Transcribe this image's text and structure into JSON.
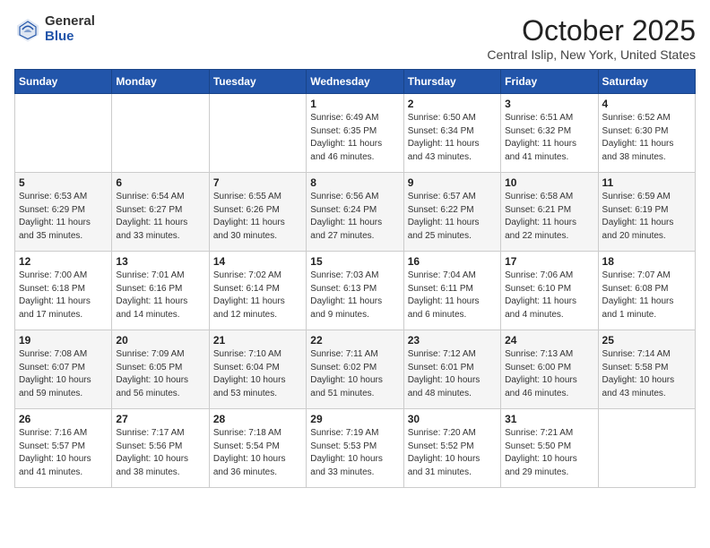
{
  "header": {
    "logo_general": "General",
    "logo_blue": "Blue",
    "month_title": "October 2025",
    "location": "Central Islip, New York, United States"
  },
  "days_of_week": [
    "Sunday",
    "Monday",
    "Tuesday",
    "Wednesday",
    "Thursday",
    "Friday",
    "Saturday"
  ],
  "weeks": [
    [
      {
        "day": "",
        "info": ""
      },
      {
        "day": "",
        "info": ""
      },
      {
        "day": "",
        "info": ""
      },
      {
        "day": "1",
        "info": "Sunrise: 6:49 AM\nSunset: 6:35 PM\nDaylight: 11 hours\nand 46 minutes."
      },
      {
        "day": "2",
        "info": "Sunrise: 6:50 AM\nSunset: 6:34 PM\nDaylight: 11 hours\nand 43 minutes."
      },
      {
        "day": "3",
        "info": "Sunrise: 6:51 AM\nSunset: 6:32 PM\nDaylight: 11 hours\nand 41 minutes."
      },
      {
        "day": "4",
        "info": "Sunrise: 6:52 AM\nSunset: 6:30 PM\nDaylight: 11 hours\nand 38 minutes."
      }
    ],
    [
      {
        "day": "5",
        "info": "Sunrise: 6:53 AM\nSunset: 6:29 PM\nDaylight: 11 hours\nand 35 minutes."
      },
      {
        "day": "6",
        "info": "Sunrise: 6:54 AM\nSunset: 6:27 PM\nDaylight: 11 hours\nand 33 minutes."
      },
      {
        "day": "7",
        "info": "Sunrise: 6:55 AM\nSunset: 6:26 PM\nDaylight: 11 hours\nand 30 minutes."
      },
      {
        "day": "8",
        "info": "Sunrise: 6:56 AM\nSunset: 6:24 PM\nDaylight: 11 hours\nand 27 minutes."
      },
      {
        "day": "9",
        "info": "Sunrise: 6:57 AM\nSunset: 6:22 PM\nDaylight: 11 hours\nand 25 minutes."
      },
      {
        "day": "10",
        "info": "Sunrise: 6:58 AM\nSunset: 6:21 PM\nDaylight: 11 hours\nand 22 minutes."
      },
      {
        "day": "11",
        "info": "Sunrise: 6:59 AM\nSunset: 6:19 PM\nDaylight: 11 hours\nand 20 minutes."
      }
    ],
    [
      {
        "day": "12",
        "info": "Sunrise: 7:00 AM\nSunset: 6:18 PM\nDaylight: 11 hours\nand 17 minutes."
      },
      {
        "day": "13",
        "info": "Sunrise: 7:01 AM\nSunset: 6:16 PM\nDaylight: 11 hours\nand 14 minutes."
      },
      {
        "day": "14",
        "info": "Sunrise: 7:02 AM\nSunset: 6:14 PM\nDaylight: 11 hours\nand 12 minutes."
      },
      {
        "day": "15",
        "info": "Sunrise: 7:03 AM\nSunset: 6:13 PM\nDaylight: 11 hours\nand 9 minutes."
      },
      {
        "day": "16",
        "info": "Sunrise: 7:04 AM\nSunset: 6:11 PM\nDaylight: 11 hours\nand 6 minutes."
      },
      {
        "day": "17",
        "info": "Sunrise: 7:06 AM\nSunset: 6:10 PM\nDaylight: 11 hours\nand 4 minutes."
      },
      {
        "day": "18",
        "info": "Sunrise: 7:07 AM\nSunset: 6:08 PM\nDaylight: 11 hours\nand 1 minute."
      }
    ],
    [
      {
        "day": "19",
        "info": "Sunrise: 7:08 AM\nSunset: 6:07 PM\nDaylight: 10 hours\nand 59 minutes."
      },
      {
        "day": "20",
        "info": "Sunrise: 7:09 AM\nSunset: 6:05 PM\nDaylight: 10 hours\nand 56 minutes."
      },
      {
        "day": "21",
        "info": "Sunrise: 7:10 AM\nSunset: 6:04 PM\nDaylight: 10 hours\nand 53 minutes."
      },
      {
        "day": "22",
        "info": "Sunrise: 7:11 AM\nSunset: 6:02 PM\nDaylight: 10 hours\nand 51 minutes."
      },
      {
        "day": "23",
        "info": "Sunrise: 7:12 AM\nSunset: 6:01 PM\nDaylight: 10 hours\nand 48 minutes."
      },
      {
        "day": "24",
        "info": "Sunrise: 7:13 AM\nSunset: 6:00 PM\nDaylight: 10 hours\nand 46 minutes."
      },
      {
        "day": "25",
        "info": "Sunrise: 7:14 AM\nSunset: 5:58 PM\nDaylight: 10 hours\nand 43 minutes."
      }
    ],
    [
      {
        "day": "26",
        "info": "Sunrise: 7:16 AM\nSunset: 5:57 PM\nDaylight: 10 hours\nand 41 minutes."
      },
      {
        "day": "27",
        "info": "Sunrise: 7:17 AM\nSunset: 5:56 PM\nDaylight: 10 hours\nand 38 minutes."
      },
      {
        "day": "28",
        "info": "Sunrise: 7:18 AM\nSunset: 5:54 PM\nDaylight: 10 hours\nand 36 minutes."
      },
      {
        "day": "29",
        "info": "Sunrise: 7:19 AM\nSunset: 5:53 PM\nDaylight: 10 hours\nand 33 minutes."
      },
      {
        "day": "30",
        "info": "Sunrise: 7:20 AM\nSunset: 5:52 PM\nDaylight: 10 hours\nand 31 minutes."
      },
      {
        "day": "31",
        "info": "Sunrise: 7:21 AM\nSunset: 5:50 PM\nDaylight: 10 hours\nand 29 minutes."
      },
      {
        "day": "",
        "info": ""
      }
    ]
  ]
}
